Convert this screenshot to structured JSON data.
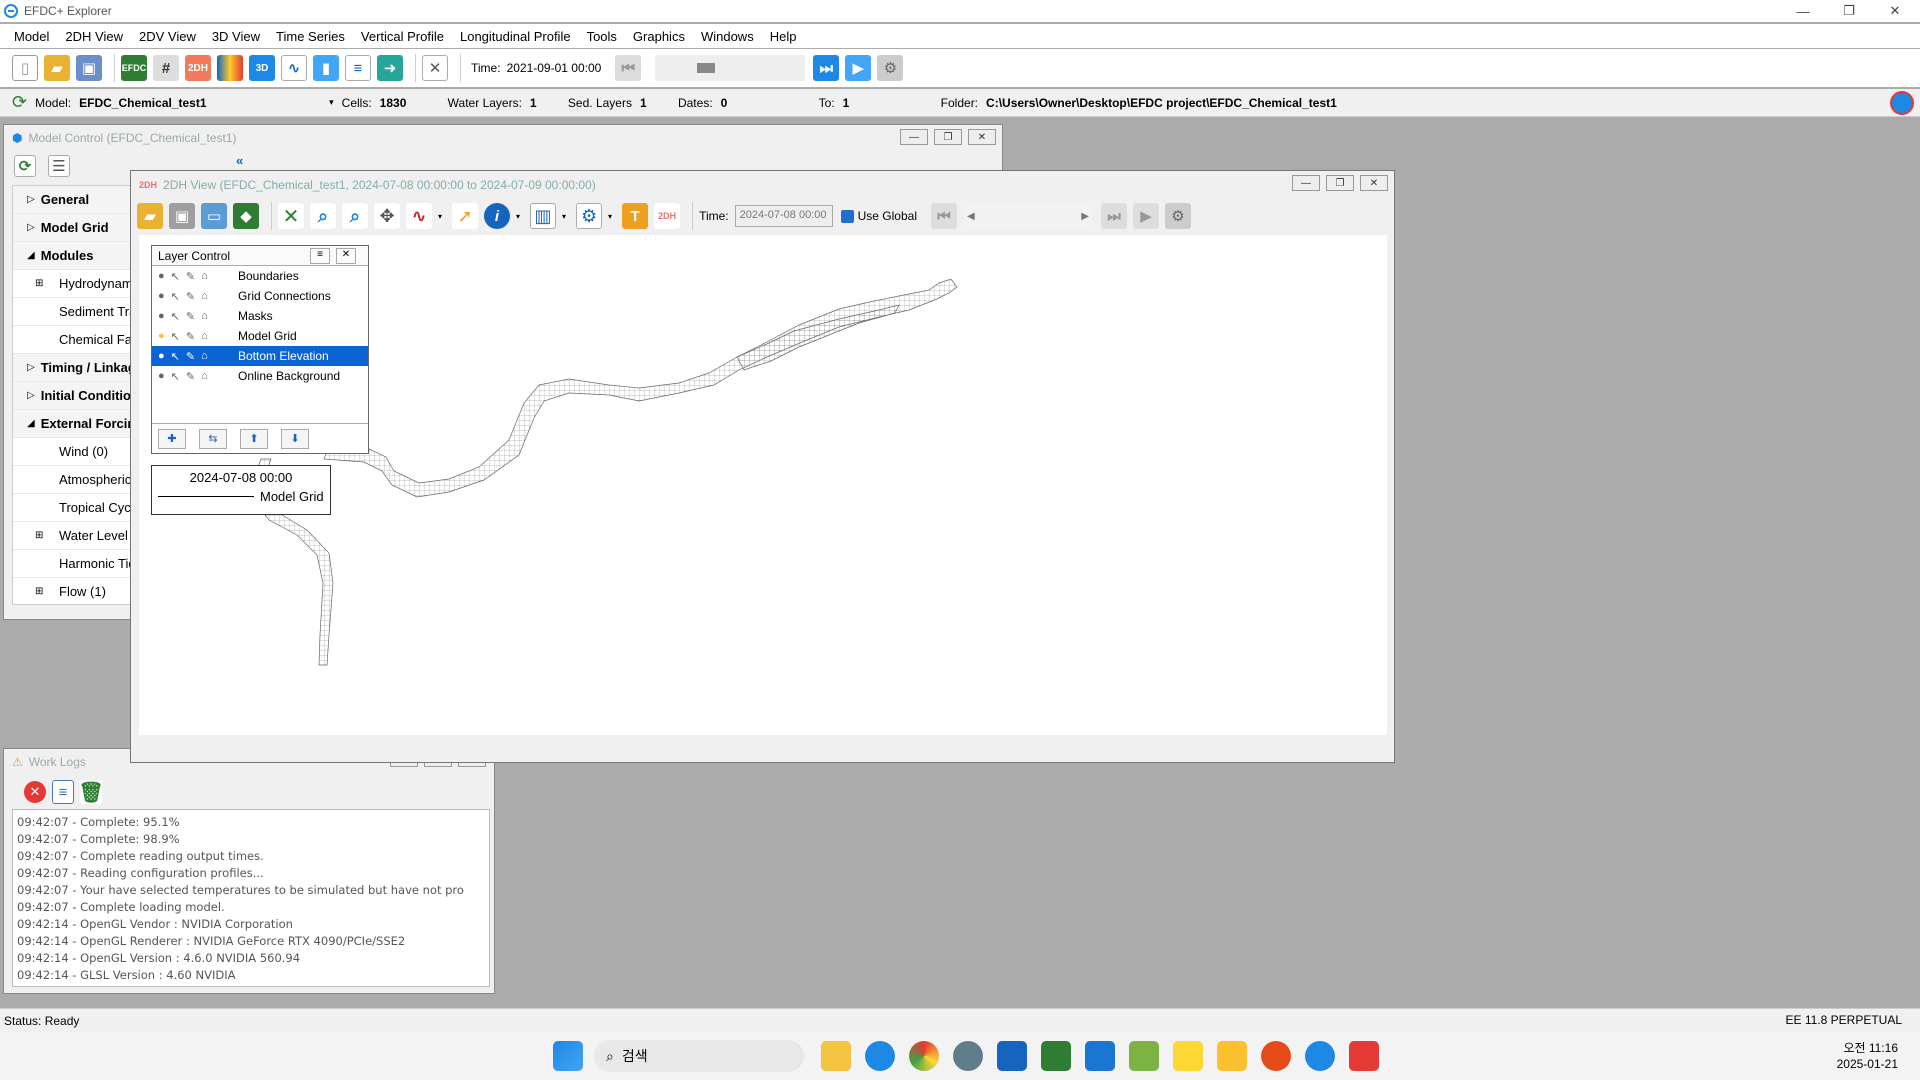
{
  "app": {
    "title": "EFDC+ Explorer"
  },
  "menu": [
    "Model",
    "2DH View",
    "2DV View",
    "3D View",
    "Time Series",
    "Vertical Profile",
    "Longitudinal Profile",
    "Tools",
    "Graphics",
    "Windows",
    "Help"
  ],
  "toolbar": {
    "time_label": "Time:",
    "time_value": "2021-09-01 00:00"
  },
  "modelbar": {
    "model_label": "Model:",
    "model_value": "EFDC_Chemical_test1",
    "cells_label": "Cells:",
    "cells_value": "1830",
    "water_layers_label": "Water Layers:",
    "water_layers_value": "1",
    "sed_layers_label": "Sed. Layers",
    "sed_layers_value": "1",
    "dates_label": "Dates:",
    "dates_value": "0",
    "to_label": "To:",
    "to_value": "1",
    "folder_label": "Folder:",
    "folder_value": "C:\\Users\\Owner\\Desktop\\EFDC project\\EFDC_Chemical_test1"
  },
  "model_control": {
    "title": "Model Control (EFDC_Chemical_test1)",
    "tree": [
      {
        "label": "General",
        "type": "section",
        "toggle": "▷"
      },
      {
        "label": "Model Grid",
        "type": "section",
        "toggle": "▷"
      },
      {
        "label": "Modules",
        "type": "section",
        "toggle": "◢"
      },
      {
        "label": "Hydrodynam",
        "type": "child",
        "toggle": "⊞"
      },
      {
        "label": "Sediment Tra",
        "type": "child",
        "toggle": ""
      },
      {
        "label": "Chemical Fat",
        "type": "child",
        "toggle": ""
      },
      {
        "label": "Timing / Linkag",
        "type": "section",
        "toggle": "▷"
      },
      {
        "label": "Initial Conditio",
        "type": "section",
        "toggle": "▷"
      },
      {
        "label": "External Forcin",
        "type": "section",
        "toggle": "◢"
      },
      {
        "label": "Wind (0)",
        "type": "child",
        "toggle": ""
      },
      {
        "label": "Atmospheric",
        "type": "child",
        "toggle": ""
      },
      {
        "label": "Tropical Cycl",
        "type": "child",
        "toggle": ""
      },
      {
        "label": "Water Level (",
        "type": "child",
        "toggle": "⊞"
      },
      {
        "label": "Harmonic Tid",
        "type": "child",
        "toggle": ""
      },
      {
        "label": "Flow (1)",
        "type": "child",
        "toggle": "⊞"
      }
    ]
  },
  "view2dh": {
    "title": "2DH View (EFDC_Chemical_test1, 2024-07-08 00:00:00 to 2024-07-09 00:00:00)",
    "time_label": "Time:",
    "time_value": "2024-07-08 00:00",
    "use_global_label": "Use Global"
  },
  "layer_control": {
    "title": "Layer Control",
    "layers": [
      {
        "label": "Boundaries",
        "selected": false,
        "lit": false
      },
      {
        "label": "Grid Connections",
        "selected": false,
        "lit": false
      },
      {
        "label": "Masks",
        "selected": false,
        "lit": false
      },
      {
        "label": "Model Grid",
        "selected": false,
        "lit": true
      },
      {
        "label": "Bottom Elevation",
        "selected": true,
        "lit": false
      },
      {
        "label": "Online Background",
        "selected": false,
        "lit": false
      }
    ]
  },
  "legend": {
    "date": "2024-07-08 00:00",
    "label": "Model Grid"
  },
  "work_logs": {
    "title": "Work Logs",
    "lines": [
      "09:42:07 - Complete: 95.1%",
      "09:42:07 - Complete: 98.9%",
      "09:42:07 - Complete reading output times.",
      "09:42:07 - Reading configuration profiles...",
      "09:42:07 - Your have selected temperatures to be simulated but have not pro",
      "09:42:07 - Complete loading model.",
      "09:42:14 - OpenGL Vendor : NVIDIA Corporation",
      "09:42:14 - OpenGL Renderer : NVIDIA GeForce RTX 4090/PCIe/SSE2",
      "09:42:14 - OpenGL Version : 4.6.0 NVIDIA 560.94",
      "09:42:14 - GLSL Version : 4.60 NVIDIA"
    ]
  },
  "status": {
    "text": "Status:  Ready",
    "version": "EE 11.8 PERPETUAL"
  },
  "taskbar": {
    "search_placeholder": "검색",
    "time": "오전 11:16",
    "date": "2025-01-21"
  },
  "colors": {
    "selection": "#0a64d4",
    "accent": "#1e88e5"
  }
}
